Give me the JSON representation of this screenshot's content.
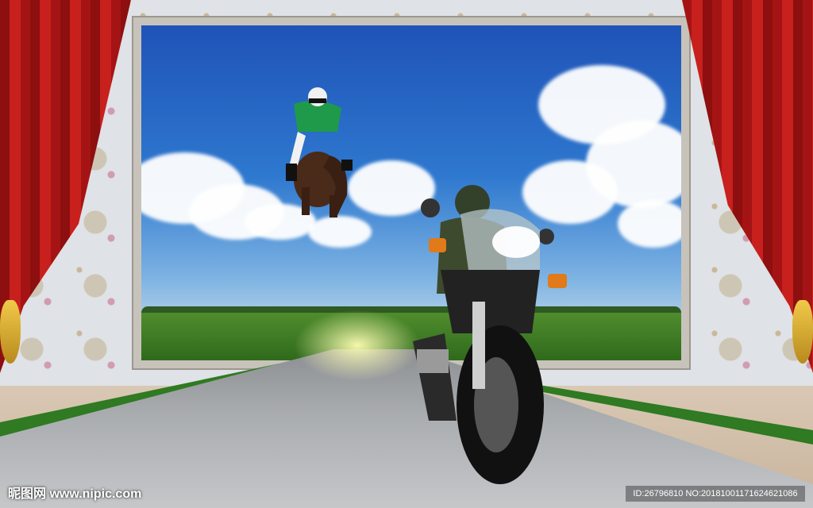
{
  "watermark": {
    "site_text": "昵图网 www.nipic.com",
    "id_text": "ID:26796810 NO:20181001171624621086"
  },
  "colors": {
    "curtain_red": "#c8201d",
    "sky_blue": "#2e78cf",
    "frame": "#c7c3bb",
    "grass": "#2f7a22"
  }
}
